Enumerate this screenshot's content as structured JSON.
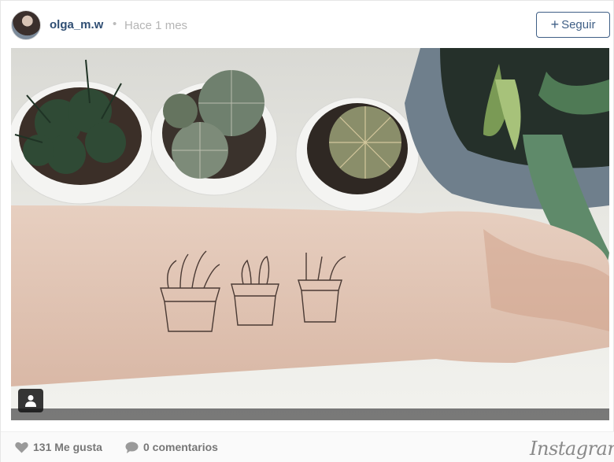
{
  "header": {
    "username": "olga_m.w",
    "separator": "•",
    "time": "Hace 1 mes",
    "follow_plus": "+",
    "follow_label": "Seguir"
  },
  "footer": {
    "likes": "131 Me gusta",
    "comments": "0 comentarios",
    "brand": "Instagram"
  },
  "icons": {
    "avatar": "profile-photo",
    "user_tag": "person-icon",
    "like": "heart-icon",
    "comment": "speech-bubble-icon"
  },
  "colors": {
    "username": "#2f4e73",
    "follow_border": "#3f5f86",
    "meta_text": "#b5b5b5"
  }
}
